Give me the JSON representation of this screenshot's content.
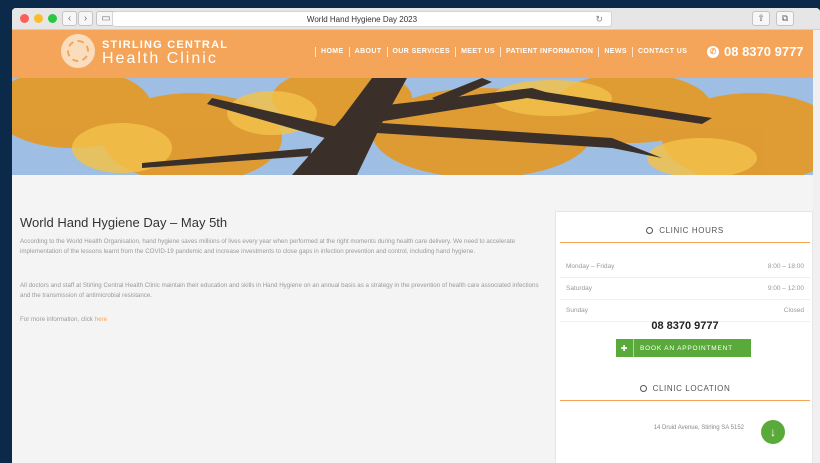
{
  "browser": {
    "tab_title": "World Hand Hygiene Day 2023",
    "back_label": "‹",
    "forward_label": "›",
    "sidebar_toggle": "▭",
    "reload_icon": "↻",
    "share_icon": "⇧",
    "tabs_icon": "⧉"
  },
  "site": {
    "logo_line1": "STIRLING CENTRAL",
    "logo_line2": "Health Clinic",
    "nav": [
      "HOME",
      "ABOUT",
      "OUR SERVICES",
      "MEET US",
      "PATIENT INFORMATION",
      "NEWS",
      "CONTACT US"
    ],
    "phone": "08 8370 9777",
    "phone_icon": "✆"
  },
  "article": {
    "title": "World Hand Hygiene Day – May 5th",
    "p1": "According to the World Health Organisation, hand hygiene saves millions of lives every year when performed at the right moments during health care delivery. We need to accelerate implementation of the lessons learnt from the COVID-19 pandemic and increase investments to close gaps in infection prevention and control, including hand hygiene.",
    "p2": "All doctors and staff at Stirling Central Health Clinic maintain their education and skills in Hand Hygiene on an annual basis as a strategy in the prevention of health care associated infections and the transmission of antimicrobial resistance.",
    "p3_prefix": "For more information, click ",
    "p3_link": "here"
  },
  "sidebar": {
    "hours_title": "CLINIC HOURS",
    "hours": [
      {
        "day": "Monday – Friday",
        "time": "8:00 – 18:00"
      },
      {
        "day": "Saturday",
        "time": "9:00 – 12:00"
      },
      {
        "day": "Sunday",
        "time": "Closed"
      }
    ],
    "phone": "08 8370 9777",
    "book_label": "BOOK AN APPOINTMENT",
    "book_icon": "✚",
    "location_title": "CLINIC LOCATION",
    "address": "14 Druid Avenue, Stirling SA 5152",
    "location_icon": "↓"
  },
  "colors": {
    "brand_orange": "#f4a55a",
    "button_green": "#5aaa3b"
  }
}
